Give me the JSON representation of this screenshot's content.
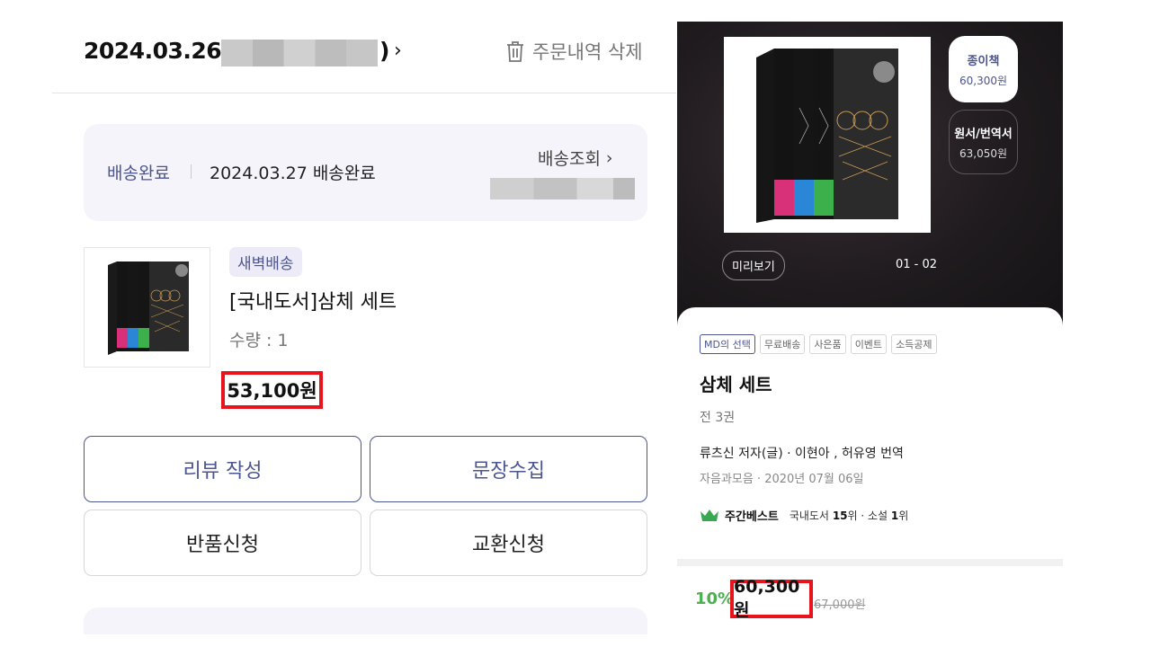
{
  "order": {
    "date": "2024.03.26(",
    "close_paren": ")",
    "delete_label": "주문내역 삭제"
  },
  "delivery": {
    "status": "배송완료",
    "detail": "2024.03.27 배송완료",
    "tracking_label": "배송조회"
  },
  "item": {
    "badge": "새벽배송",
    "title": "[국내도서]삼체 세트",
    "quantity": "수량 : 1",
    "price": "53,100원"
  },
  "actions": {
    "review": "리뷰 작성",
    "quote": "문장수집",
    "return": "반품신청",
    "exchange": "교환신청"
  },
  "detail": {
    "formats": [
      {
        "name": "종이책",
        "price": "60,300원"
      },
      {
        "name": "원서/번역서",
        "price": "63,050원"
      }
    ],
    "preview": "미리보기",
    "pager": "01 - 02",
    "tags": [
      "MD의 선택",
      "무료배송",
      "사은품",
      "이벤트",
      "소득공제"
    ],
    "title": "삼체 세트",
    "volumes": "전 3권",
    "author": "류츠신 저자(글) · 이현아 , 허유영 번역",
    "publisher": "자음과모음 · 2020년 07월 06일",
    "best_label": "주간베스트",
    "rank_cat1": "국내도서",
    "rank_num1": "15",
    "rank_cat2": "위 · 소설",
    "rank_num2": "1",
    "rank_end": "위",
    "discount": "10%",
    "sale_price": "60,300원",
    "original_price": "67,000원"
  },
  "colors": {
    "accent": "#4b5592",
    "highlight": "#e8141b",
    "discount": "#4caf50"
  }
}
